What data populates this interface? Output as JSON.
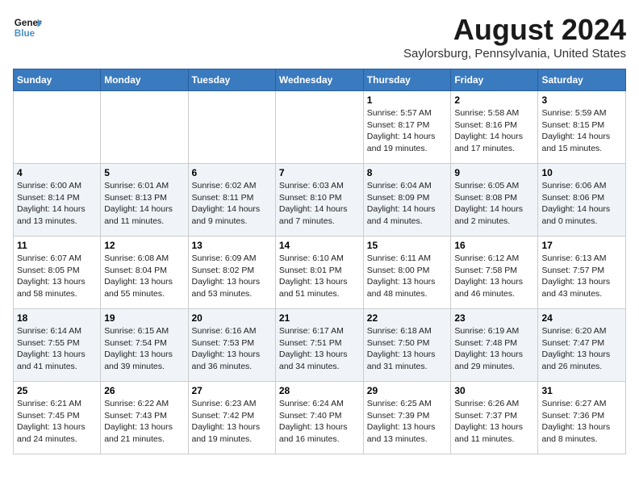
{
  "header": {
    "logo_line1": "General",
    "logo_line2": "Blue",
    "month_year": "August 2024",
    "location": "Saylorsburg, Pennsylvania, United States"
  },
  "weekdays": [
    "Sunday",
    "Monday",
    "Tuesday",
    "Wednesday",
    "Thursday",
    "Friday",
    "Saturday"
  ],
  "weeks": [
    [
      {
        "day": "",
        "info": ""
      },
      {
        "day": "",
        "info": ""
      },
      {
        "day": "",
        "info": ""
      },
      {
        "day": "",
        "info": ""
      },
      {
        "day": "1",
        "info": "Sunrise: 5:57 AM\nSunset: 8:17 PM\nDaylight: 14 hours\nand 19 minutes."
      },
      {
        "day": "2",
        "info": "Sunrise: 5:58 AM\nSunset: 8:16 PM\nDaylight: 14 hours\nand 17 minutes."
      },
      {
        "day": "3",
        "info": "Sunrise: 5:59 AM\nSunset: 8:15 PM\nDaylight: 14 hours\nand 15 minutes."
      }
    ],
    [
      {
        "day": "4",
        "info": "Sunrise: 6:00 AM\nSunset: 8:14 PM\nDaylight: 14 hours\nand 13 minutes."
      },
      {
        "day": "5",
        "info": "Sunrise: 6:01 AM\nSunset: 8:13 PM\nDaylight: 14 hours\nand 11 minutes."
      },
      {
        "day": "6",
        "info": "Sunrise: 6:02 AM\nSunset: 8:11 PM\nDaylight: 14 hours\nand 9 minutes."
      },
      {
        "day": "7",
        "info": "Sunrise: 6:03 AM\nSunset: 8:10 PM\nDaylight: 14 hours\nand 7 minutes."
      },
      {
        "day": "8",
        "info": "Sunrise: 6:04 AM\nSunset: 8:09 PM\nDaylight: 14 hours\nand 4 minutes."
      },
      {
        "day": "9",
        "info": "Sunrise: 6:05 AM\nSunset: 8:08 PM\nDaylight: 14 hours\nand 2 minutes."
      },
      {
        "day": "10",
        "info": "Sunrise: 6:06 AM\nSunset: 8:06 PM\nDaylight: 14 hours\nand 0 minutes."
      }
    ],
    [
      {
        "day": "11",
        "info": "Sunrise: 6:07 AM\nSunset: 8:05 PM\nDaylight: 13 hours\nand 58 minutes."
      },
      {
        "day": "12",
        "info": "Sunrise: 6:08 AM\nSunset: 8:04 PM\nDaylight: 13 hours\nand 55 minutes."
      },
      {
        "day": "13",
        "info": "Sunrise: 6:09 AM\nSunset: 8:02 PM\nDaylight: 13 hours\nand 53 minutes."
      },
      {
        "day": "14",
        "info": "Sunrise: 6:10 AM\nSunset: 8:01 PM\nDaylight: 13 hours\nand 51 minutes."
      },
      {
        "day": "15",
        "info": "Sunrise: 6:11 AM\nSunset: 8:00 PM\nDaylight: 13 hours\nand 48 minutes."
      },
      {
        "day": "16",
        "info": "Sunrise: 6:12 AM\nSunset: 7:58 PM\nDaylight: 13 hours\nand 46 minutes."
      },
      {
        "day": "17",
        "info": "Sunrise: 6:13 AM\nSunset: 7:57 PM\nDaylight: 13 hours\nand 43 minutes."
      }
    ],
    [
      {
        "day": "18",
        "info": "Sunrise: 6:14 AM\nSunset: 7:55 PM\nDaylight: 13 hours\nand 41 minutes."
      },
      {
        "day": "19",
        "info": "Sunrise: 6:15 AM\nSunset: 7:54 PM\nDaylight: 13 hours\nand 39 minutes."
      },
      {
        "day": "20",
        "info": "Sunrise: 6:16 AM\nSunset: 7:53 PM\nDaylight: 13 hours\nand 36 minutes."
      },
      {
        "day": "21",
        "info": "Sunrise: 6:17 AM\nSunset: 7:51 PM\nDaylight: 13 hours\nand 34 minutes."
      },
      {
        "day": "22",
        "info": "Sunrise: 6:18 AM\nSunset: 7:50 PM\nDaylight: 13 hours\nand 31 minutes."
      },
      {
        "day": "23",
        "info": "Sunrise: 6:19 AM\nSunset: 7:48 PM\nDaylight: 13 hours\nand 29 minutes."
      },
      {
        "day": "24",
        "info": "Sunrise: 6:20 AM\nSunset: 7:47 PM\nDaylight: 13 hours\nand 26 minutes."
      }
    ],
    [
      {
        "day": "25",
        "info": "Sunrise: 6:21 AM\nSunset: 7:45 PM\nDaylight: 13 hours\nand 24 minutes."
      },
      {
        "day": "26",
        "info": "Sunrise: 6:22 AM\nSunset: 7:43 PM\nDaylight: 13 hours\nand 21 minutes."
      },
      {
        "day": "27",
        "info": "Sunrise: 6:23 AM\nSunset: 7:42 PM\nDaylight: 13 hours\nand 19 minutes."
      },
      {
        "day": "28",
        "info": "Sunrise: 6:24 AM\nSunset: 7:40 PM\nDaylight: 13 hours\nand 16 minutes."
      },
      {
        "day": "29",
        "info": "Sunrise: 6:25 AM\nSunset: 7:39 PM\nDaylight: 13 hours\nand 13 minutes."
      },
      {
        "day": "30",
        "info": "Sunrise: 6:26 AM\nSunset: 7:37 PM\nDaylight: 13 hours\nand 11 minutes."
      },
      {
        "day": "31",
        "info": "Sunrise: 6:27 AM\nSunset: 7:36 PM\nDaylight: 13 hours\nand 8 minutes."
      }
    ]
  ]
}
